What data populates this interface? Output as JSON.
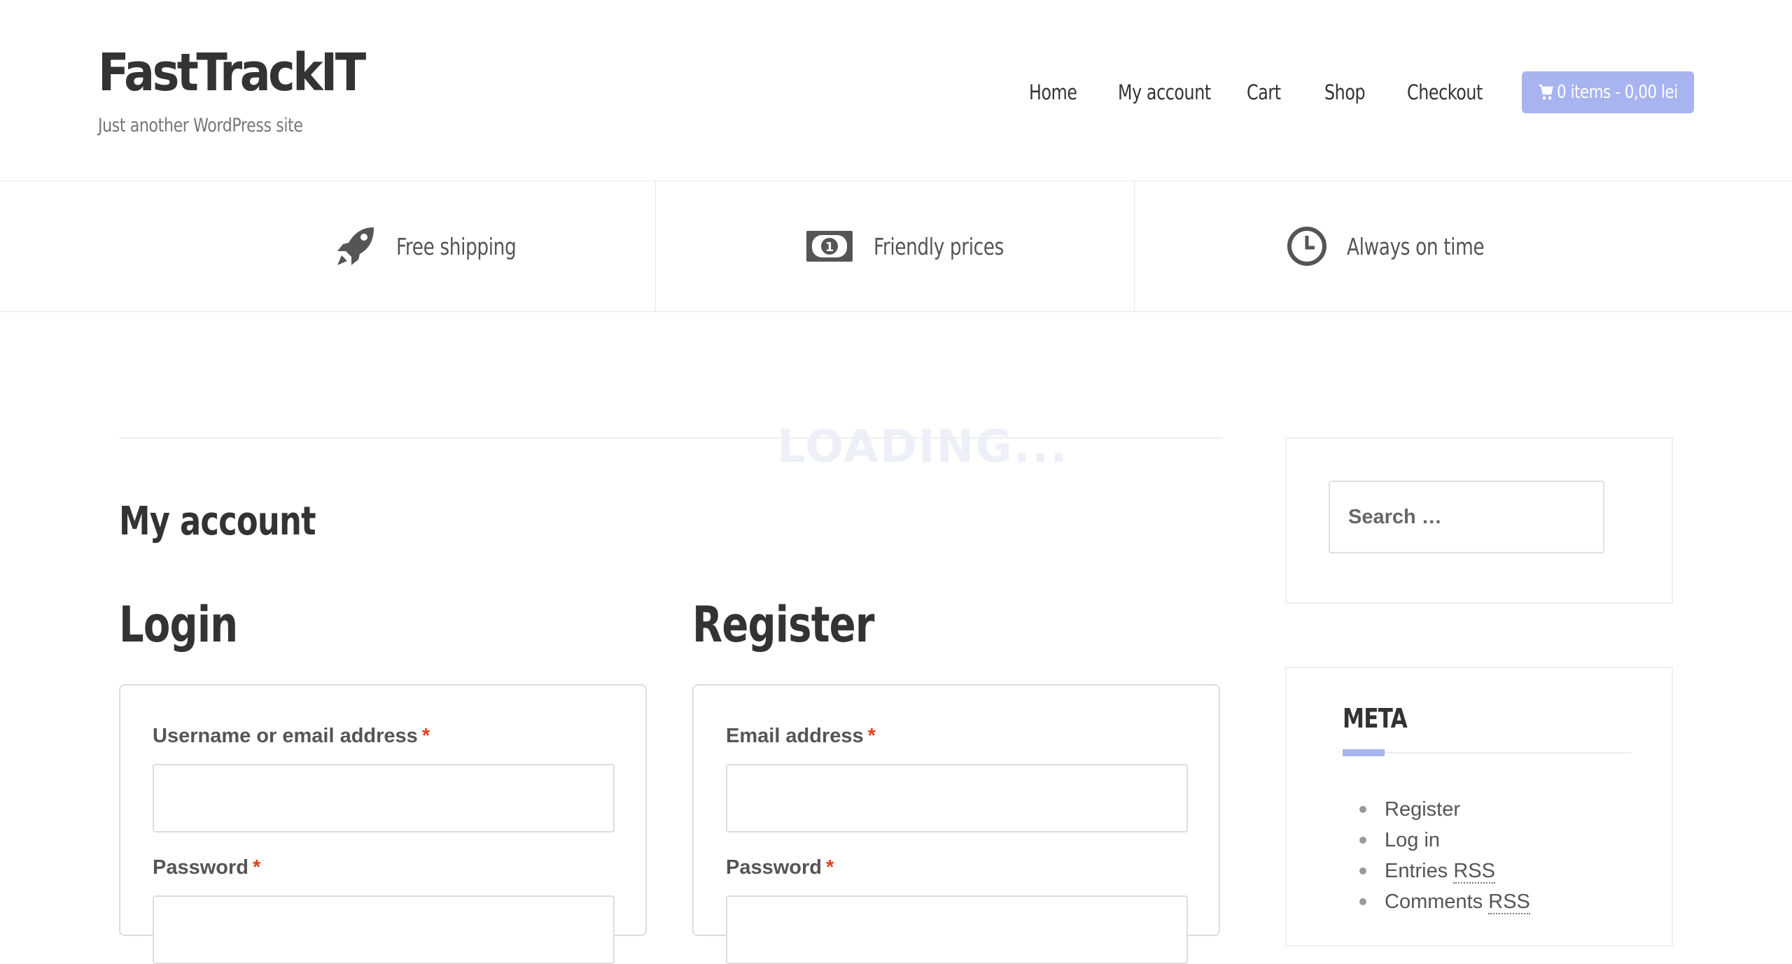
{
  "site": {
    "title": "FastTrackIT",
    "tagline": "Just another WordPress site"
  },
  "nav": {
    "items": [
      {
        "label": "Home"
      },
      {
        "label": "My account"
      },
      {
        "label": "Cart"
      },
      {
        "label": "Shop"
      },
      {
        "label": "Checkout"
      }
    ],
    "cart_label": "0 items - 0,00 lei"
  },
  "features": [
    {
      "icon": "rocket-icon",
      "label": "Free shipping"
    },
    {
      "icon": "money-icon",
      "label": "Friendly prices"
    },
    {
      "icon": "clock-icon",
      "label": "Always on time"
    }
  ],
  "loading_text": "LOADING...",
  "main": {
    "page_title": "My account",
    "login": {
      "title": "Login",
      "username_label": "Username or email address",
      "password_label": "Password",
      "required_mark": "*"
    },
    "register": {
      "title": "Register",
      "email_label": "Email address",
      "password_label": "Password",
      "required_mark": "*"
    }
  },
  "sidebar": {
    "search_placeholder": "Search …",
    "meta": {
      "title": "META",
      "links": [
        {
          "text": "Register",
          "abbr": ""
        },
        {
          "text": "Log in",
          "abbr": ""
        },
        {
          "text": "Entries ",
          "abbr": "RSS"
        },
        {
          "text": "Comments ",
          "abbr": "RSS"
        }
      ]
    }
  },
  "colors": {
    "accent": "#a8b4f0",
    "required": "#e2401c",
    "text": "#333333"
  }
}
